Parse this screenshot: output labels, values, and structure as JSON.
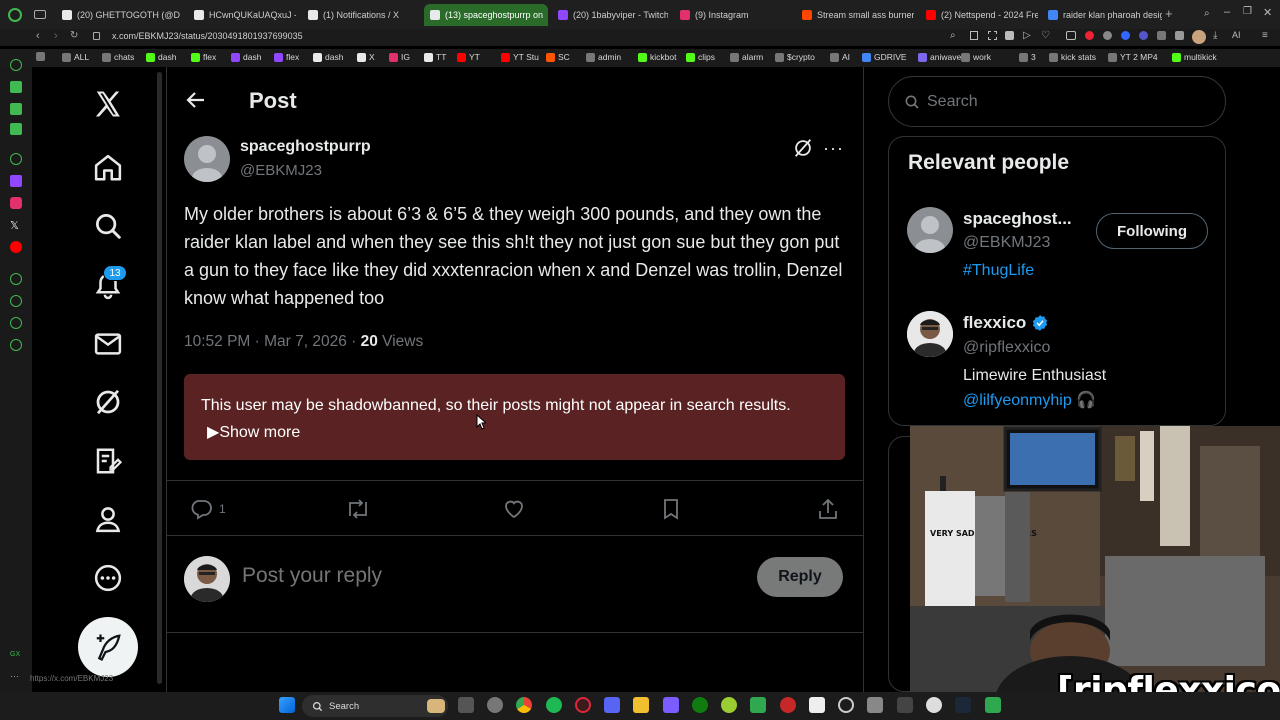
{
  "browser": {
    "tabs": [
      {
        "title": "(20) GHETTOGOTH (@D",
        "icon_color": "#e7e9ea",
        "icon": "x-logo-icon"
      },
      {
        "title": "HCwnQUKaUAQxuJ - (2",
        "icon_color": "#e7e9ea",
        "icon": "x-logo-icon"
      },
      {
        "title": "(1) Notifications / X",
        "icon_color": "#e7e9ea",
        "icon": "x-logo-icon"
      },
      {
        "title": "(13) spaceghostpurrp on",
        "icon_color": "#e7e9ea",
        "icon": "x-logo-icon",
        "active": true
      },
      {
        "title": "(20) 1babyviper - Twitch",
        "icon_color": "#9146ff",
        "icon": "twitch-icon"
      },
      {
        "title": "(9) Instagram",
        "icon_color": "#e1306c",
        "icon": "instagram-icon"
      },
      {
        "title": "Stream small ass burner",
        "icon_color": "#ff4500",
        "icon": "stream-icon"
      },
      {
        "title": "(2) Nettspend - 2024 Fre",
        "icon_color": "#ff0000",
        "icon": "youtube-icon"
      },
      {
        "title": "raider klan pharoah desig",
        "icon_color": "#4285f4",
        "icon": "google-icon"
      }
    ],
    "new_tab": "+",
    "url": "x.com/EBKMJ23/status/2030491801937699035",
    "bookmarks": [
      {
        "label": "",
        "color": "#777"
      },
      {
        "label": "ALL",
        "color": "#777"
      },
      {
        "label": "chats",
        "color": "#777"
      },
      {
        "label": "dash",
        "color": "#53fc18"
      },
      {
        "label": "flex",
        "color": "#53fc18"
      },
      {
        "label": "dash",
        "color": "#9146ff"
      },
      {
        "label": "flex",
        "color": "#9146ff"
      },
      {
        "label": "dash",
        "color": "#e7e9ea"
      },
      {
        "label": "X",
        "color": "#e7e9ea"
      },
      {
        "label": "IG",
        "color": "#e1306c"
      },
      {
        "label": "TT",
        "color": "#e7e9ea"
      },
      {
        "label": "YT",
        "color": "#ff0000"
      },
      {
        "label": "YT Stu",
        "color": "#ff0000"
      },
      {
        "label": "SC",
        "color": "#ff5500"
      },
      {
        "label": "admin",
        "color": "#777"
      },
      {
        "label": "kickbot",
        "color": "#53fc18"
      },
      {
        "label": "clips",
        "color": "#53fc18"
      },
      {
        "label": "alarm",
        "color": "#777"
      },
      {
        "label": "$crypto",
        "color": "#777"
      },
      {
        "label": "AI",
        "color": "#777"
      },
      {
        "label": "GDRIVE",
        "color": "#4285f4"
      },
      {
        "label": "aniwave",
        "color": "#7b68ee"
      },
      {
        "label": "work",
        "color": "#777"
      },
      {
        "label": "3",
        "color": "#777"
      },
      {
        "label": "kick stats",
        "color": "#777"
      },
      {
        "label": "YT 2 MP4",
        "color": "#777"
      },
      {
        "label": "multikick",
        "color": "#53fc18"
      }
    ],
    "status_url": "https://x.com/EBKMJ23"
  },
  "nav": {
    "notification_count": "13",
    "items": [
      "x-logo",
      "home",
      "explore",
      "notifications",
      "messages",
      "grok",
      "lists",
      "profile",
      "more"
    ]
  },
  "post": {
    "header_title": "Post",
    "author_name": "spaceghostpurrp",
    "author_handle": "@EBKMJ23",
    "text": "My older brothers is about 6’3 & 6’5 & they weigh 300 pounds, and they own the raider klan label and when they see this sh!t they not just gon sue but they gon put a gun to they face like they did xxxtenracion when x and Denzel was trollin, Denzel know what happened too",
    "time": "10:52 PM · Mar 7, 2026 · ",
    "views_count": "20",
    "views_label": " Views",
    "notice_text": "This user may be shadowbanned, so their posts might not appear in search results.",
    "notice_show_more": "Show more",
    "reply_count": "1",
    "reply_placeholder": "Post your reply",
    "reply_button": "Reply"
  },
  "sidebar": {
    "search_placeholder": "Search",
    "relevant_title": "Relevant people",
    "people": [
      {
        "name": "spaceghost...",
        "handle": "@EBKMJ23",
        "bio_link": "#ThugLife",
        "button": "Following"
      },
      {
        "name": "flexxico",
        "handle": "@ripflexxico",
        "bio": "Limewire Enthusiast",
        "bio_link": "@lilfyeonmyhip 🎧",
        "verified": true
      }
    ]
  },
  "webcam": {
    "label": "[ripflexxico]",
    "shirt_text": "VERY SAD GUCCI TEARS"
  },
  "taskbar": {
    "search_label": "Search"
  },
  "colors": {
    "accent": "#1d9bf0",
    "notice_bg": "#5a2222",
    "active_tab": "#2a6b2a"
  }
}
